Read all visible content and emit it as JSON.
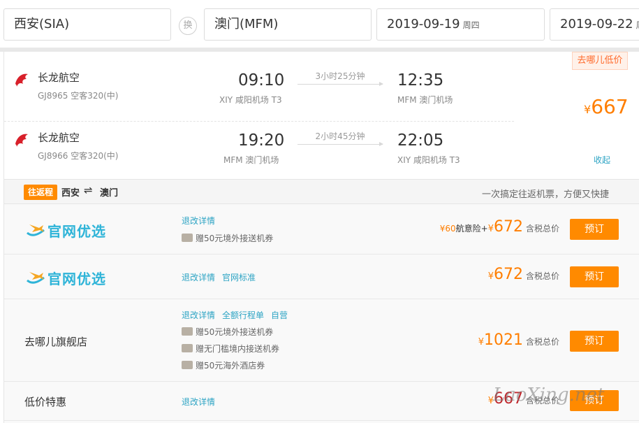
{
  "search": {
    "from": "西安(SIA)",
    "swap_label": "换",
    "to": "澳门(MFM)",
    "depart_date": "2019-09-19",
    "depart_weekday": "周四",
    "return_date": "2019-09-22",
    "return_weekday": "周日"
  },
  "itinerary": {
    "low_tag": "去哪儿低价",
    "price_symbol": "¥",
    "price": "667",
    "collapse_label": "收起",
    "legs": [
      {
        "airline": "长龙航空",
        "flight": "GJ8965 空客320(中)",
        "dep_time": "09:10",
        "dep_airport": "XIY 咸阳机场 T3",
        "duration": "3小时25分钟",
        "arr_time": "12:35",
        "arr_airport": "MFM 澳门机场"
      },
      {
        "airline": "长龙航空",
        "flight": "GJ8966 空客320(中)",
        "dep_time": "19:20",
        "dep_airport": "MFM 澳门机场",
        "duration": "2小时45分钟",
        "arr_time": "22:05",
        "arr_airport": "XIY 咸阳机场 T3"
      }
    ]
  },
  "roundtrip_bar": {
    "badge": "往返程",
    "from": "西安",
    "arrow": "⇌",
    "to": "澳门",
    "slogan": "一次搞定往返机票，方便又快捷"
  },
  "offers": [
    {
      "vendor": "官网优选",
      "links": [
        "退改详情"
      ],
      "gifts": [
        "赠50元境外接送机券"
      ],
      "insurance_price": "¥60",
      "insurance_label": "航意险+",
      "price_symbol": "¥",
      "price": "672",
      "tax_label": "含税总价",
      "book_label": "预订"
    },
    {
      "vendor": "官网优选",
      "links": [
        "退改详情",
        "官网标准"
      ],
      "gifts": [],
      "price_symbol": "¥",
      "price": "672",
      "tax_label": "含税总价",
      "book_label": "预订"
    },
    {
      "vendor": "去哪儿旗舰店",
      "links": [
        "退改详情",
        "全额行程单",
        "自营"
      ],
      "gifts": [
        "赠50元境外接送机券",
        "赠无门槛境内接送机券",
        "赠50元海外酒店券"
      ],
      "price_symbol": "¥",
      "price": "1021",
      "tax_label": "含税总价",
      "book_label": "预订"
    },
    {
      "vendor": "低价特惠",
      "links": [
        "退改详情"
      ],
      "gifts": [],
      "price_symbol": "¥",
      "price": "667",
      "tax_label": "含税总价",
      "book_label": "预订"
    }
  ],
  "watermark": "LaoXing.net",
  "colors": {
    "accent_orange": "#ff8a00",
    "price_orange": "#ff7e00",
    "link_blue": "#2da4c4",
    "brand_cyan": "#2fb4d8",
    "airline_red": "#d8202a"
  },
  "icons": {
    "airline_logo": "dragon-logo-icon",
    "vendor_logo": "plane-swoosh-icon",
    "gift": "ticket-icon"
  }
}
